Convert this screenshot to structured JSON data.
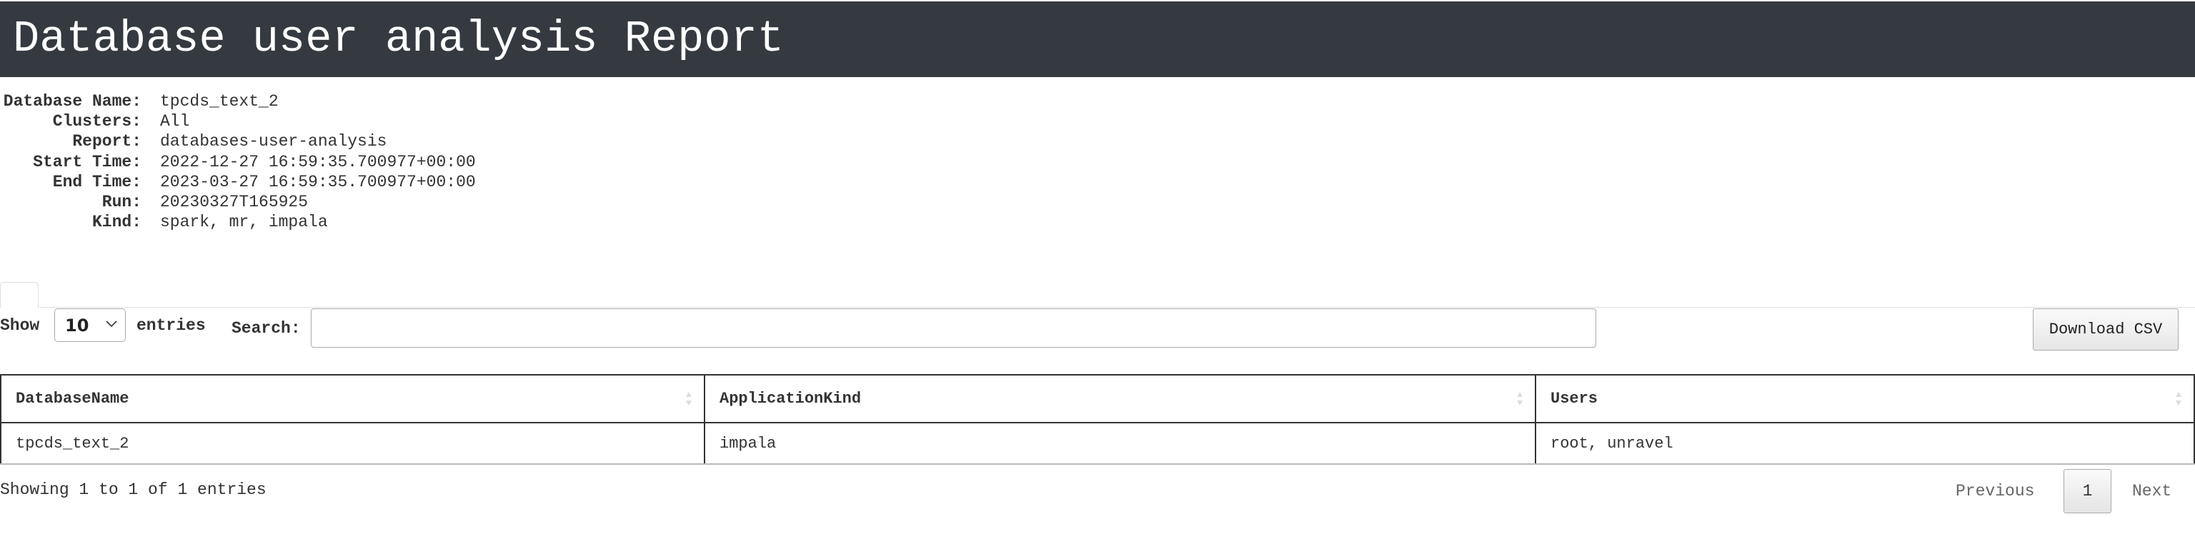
{
  "header": {
    "title": "Database user analysis Report"
  },
  "meta": [
    {
      "label": "Database Name:",
      "value": "tpcds_text_2"
    },
    {
      "label": "Clusters:",
      "value": "All"
    },
    {
      "label": "Report:",
      "value": "databases-user-analysis"
    },
    {
      "label": "Start Time:",
      "value": "2022-12-27 16:59:35.700977+00:00"
    },
    {
      "label": "End Time:",
      "value": "2023-03-27 16:59:35.700977+00:00"
    },
    {
      "label": "Run:",
      "value": "20230327T165925"
    },
    {
      "label": "Kind:",
      "value": "spark, mr, impala"
    }
  ],
  "controls": {
    "show_label": "Show",
    "page_length": "10",
    "entries_label": "entries",
    "search_label": "Search:",
    "search_value": "",
    "download_label": "Download CSV"
  },
  "table": {
    "columns": [
      "DatabaseName",
      "ApplicationKind",
      "Users"
    ],
    "rows": [
      [
        "tpcds_text_2",
        "impala",
        "root, unravel"
      ]
    ]
  },
  "footer": {
    "info": "Showing 1 to 1 of 1 entries",
    "previous_label": "Previous",
    "current_page": "1",
    "next_label": "Next"
  },
  "icons": {
    "sort": "sort-both-icon",
    "dropdown": "chevron-down-icon"
  }
}
